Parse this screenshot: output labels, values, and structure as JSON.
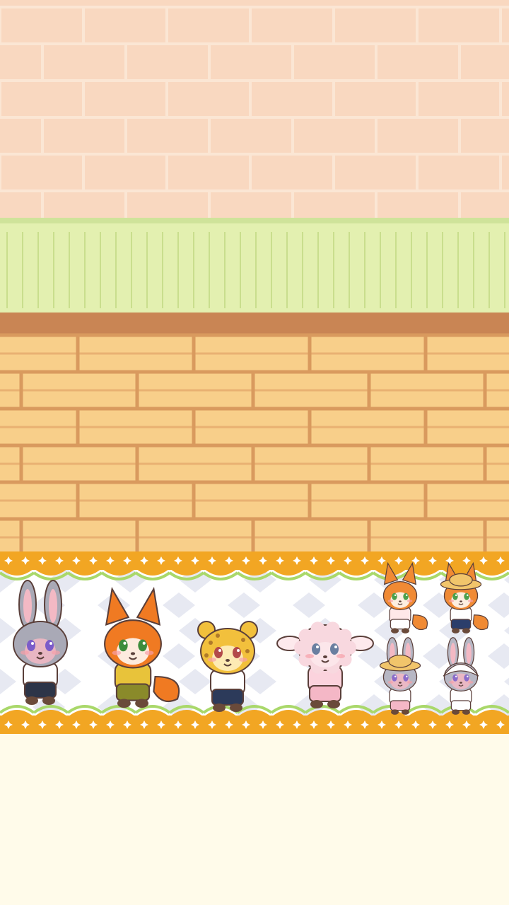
{
  "scene": {
    "name": "character-shelf-room",
    "colors": {
      "upper_wall": "#f9d8c0",
      "upper_wall_mortar": "#fbe6d4",
      "wainscot": "#e3f0b0",
      "wainscot_line": "#c9de8d",
      "shelf_rail": "#c98554",
      "lower_wall": "#f8cf8a",
      "lower_wall_mortar": "#d99a5e",
      "trim_orange": "#f2a623",
      "trim_green": "#a9d86a",
      "checker_light": "#ffffff",
      "checker_dark": "#e7e9f2",
      "floor": "#fffbea"
    }
  },
  "characters": [
    {
      "name": "gray-bunny-overalls",
      "species": "bunny",
      "fur": "#a9a9b6",
      "inner": "#f3b9c4",
      "eye": "#7b5cc9",
      "shirt": "#ffffff",
      "pants": "#2d3548"
    },
    {
      "name": "orange-fox-yellow-shirt",
      "species": "fox",
      "fur": "#f07a22",
      "inner": "#ffffff",
      "eye": "#3c8c3c",
      "shirt": "#e8c33a",
      "pants": "#8a8a2a"
    },
    {
      "name": "leopard-white-shirt",
      "species": "leopard",
      "fur": "#f2c03c",
      "inner": "#fff1c9",
      "eye": "#b34a4a",
      "shirt": "#ffffff",
      "pants": "#2c3a5a"
    },
    {
      "name": "pink-sheep",
      "species": "sheep",
      "fur": "#f8d8df",
      "inner": "#fde9ec",
      "eye": "#6a7fa0",
      "shirt": "#fbd3dd",
      "pants": "#f4b7c6"
    },
    {
      "name": "small-fox-pink-shirt",
      "species": "fox",
      "fur": "#f08a34",
      "inner": "#ffffff",
      "eye": "#4ca04c",
      "shirt": "#ffe8e8",
      "pants": "#ffffff"
    },
    {
      "name": "small-fox-straw-hat",
      "species": "fox",
      "fur": "#f08a34",
      "inner": "#ffffff",
      "eye": "#4ca04c",
      "shirt": "#ffffff",
      "pants": "#2b3e6b"
    },
    {
      "name": "small-bunny-straw-hat",
      "species": "bunny",
      "fur": "#b7b7c4",
      "inner": "#f3b9c4",
      "eye": "#8a6cc9",
      "shirt": "#ffffff",
      "pants": "#f4b7c6"
    },
    {
      "name": "small-bunny-white-bonnet",
      "species": "bunny",
      "fur": "#b7b7c4",
      "inner": "#f3b9c4",
      "eye": "#8a6cc9",
      "shirt": "#ffffff",
      "pants": "#ffffff"
    }
  ]
}
